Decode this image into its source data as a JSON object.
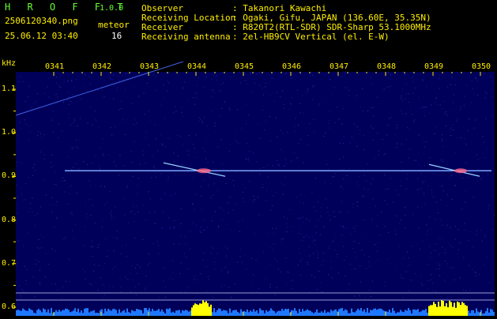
{
  "header": {
    "app_name": "H R O F F T",
    "version": "1.0.0",
    "filename": "2506120340.png",
    "timestamp": "25.06.12 03:40",
    "meteor_label": "meteor",
    "meteor_count": "16",
    "info": [
      {
        "key": "Observer",
        "value": ": Takanori Kawachi"
      },
      {
        "key": "Receiving Location",
        "value": ": Ogaki, Gifu, JAPAN (136.60E, 35.35N)"
      },
      {
        "key": "Receiver",
        "value": ": R820T2(RTL-SDR) SDR-Sharp 53.1000MHz"
      },
      {
        "key": "Receiving antenna",
        "value": ": 2el-HB9CV Vertical (el. E-W)"
      }
    ]
  },
  "chart_data": {
    "type": "heatmap",
    "ylabel": "kHz",
    "x_ticks": [
      "0341",
      "0342",
      "0343",
      "0344",
      "0345",
      "0346",
      "0347",
      "0348",
      "0349",
      "0350"
    ],
    "y_ticks": [
      "1.1",
      "1.0",
      "0.9",
      "0.8",
      "0.7",
      "0.6"
    ],
    "ylim": [
      0.58,
      1.14
    ],
    "carrier_khz": 0.913,
    "colors": {
      "background": "#00005a",
      "noise": "#3030c0",
      "trace": "#7aa8ff",
      "tick": "#ffee00",
      "spectrum": "#ffff00",
      "spectrum_low": "#1e78ff"
    }
  }
}
